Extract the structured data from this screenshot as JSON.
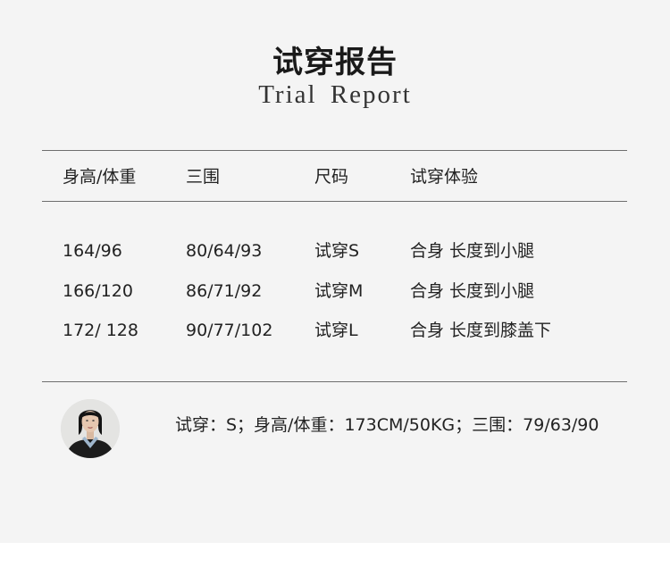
{
  "title": {
    "cn": "试穿报告",
    "en": "Trial Report"
  },
  "table": {
    "headers": [
      "身高/体重",
      "三围",
      "尺码",
      "试穿体验"
    ],
    "rows": [
      [
        "164/96",
        "80/64/93",
        "试穿S",
        "合身 长度到小腿"
      ],
      [
        "166/120",
        "86/71/92",
        "试穿M",
        "合身 长度到小腿"
      ],
      [
        "172/ 128",
        "90/77/102",
        "试穿L",
        "合身 长度到膝盖下"
      ]
    ]
  },
  "model": {
    "info": "试穿：S；身高/体重：173CM/50KG；三围：79/63/90"
  },
  "colors": {
    "panel_bg": "#f4f4f4",
    "rule": "#6e6e6e",
    "text": "#222222"
  }
}
